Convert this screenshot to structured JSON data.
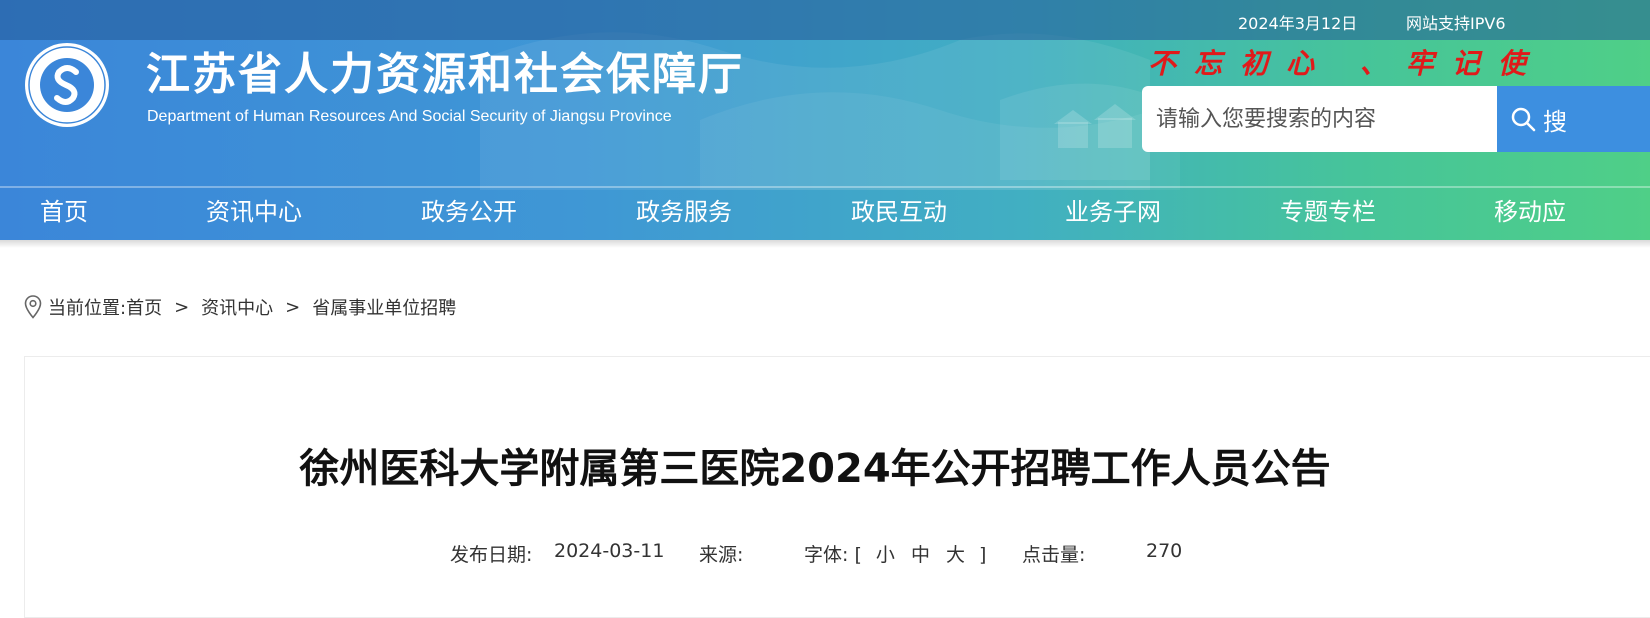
{
  "topbar": {
    "date": "2024年3月12日",
    "ipv6": "网站支持IPV6"
  },
  "site": {
    "title": "江苏省人力资源和社会保障厅",
    "subtitle": "Department of Human Resources And Social Security of Jiangsu Province",
    "logo_text": "江苏省人力资源和社会保障厅",
    "slogan": "不忘初心 、牢记使"
  },
  "search": {
    "placeholder": "请输入您要搜索的内容",
    "button_label": "搜"
  },
  "nav": [
    "首页",
    "资讯中心",
    "政务公开",
    "政务服务",
    "政民互动",
    "业务子网",
    "专题专栏",
    "移动应"
  ],
  "breadcrumb": {
    "prefix": "当前位置:",
    "items": [
      "首页",
      "资讯中心",
      "省属事业单位招聘"
    ],
    "separator": ">"
  },
  "article": {
    "title": "徐州医科大学附属第三医院2024年公开招聘工作人员公告",
    "publish_label": "发布日期:",
    "publish_date": "2024-03-11",
    "source_label": "来源:",
    "source_value": "",
    "font_label": "字体:",
    "font_open": "[",
    "font_small": "小",
    "font_medium": "中",
    "font_large": "大",
    "font_close": "]",
    "views_label": "点击量:",
    "views_value": "270"
  },
  "colors": {
    "header_start": "#3b86d9",
    "header_end": "#4fcf87",
    "slogan": "#e01a1a",
    "search_button": "#3d8fe0"
  }
}
